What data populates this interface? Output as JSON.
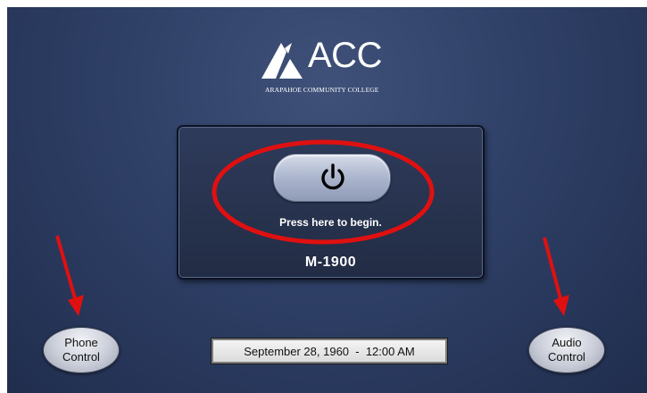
{
  "logo": {
    "title": "ACC",
    "subtitle": "ARAPAHOE COMMUNITY COLLEGE"
  },
  "panel": {
    "power_icon": "power-icon",
    "press_label": "Press here to begin.",
    "room_label": "M-1900"
  },
  "buttons": {
    "phone_label_1": "Phone",
    "phone_label_2": "Control",
    "audio_label_1": "Audio",
    "audio_label_2": "Control"
  },
  "status": {
    "datetime": "September 28, 1960  -  12:00 AM"
  },
  "colors": {
    "background": "#2f4067",
    "annotation_red": "#e01010",
    "button_silver": "#c9cdd8"
  }
}
